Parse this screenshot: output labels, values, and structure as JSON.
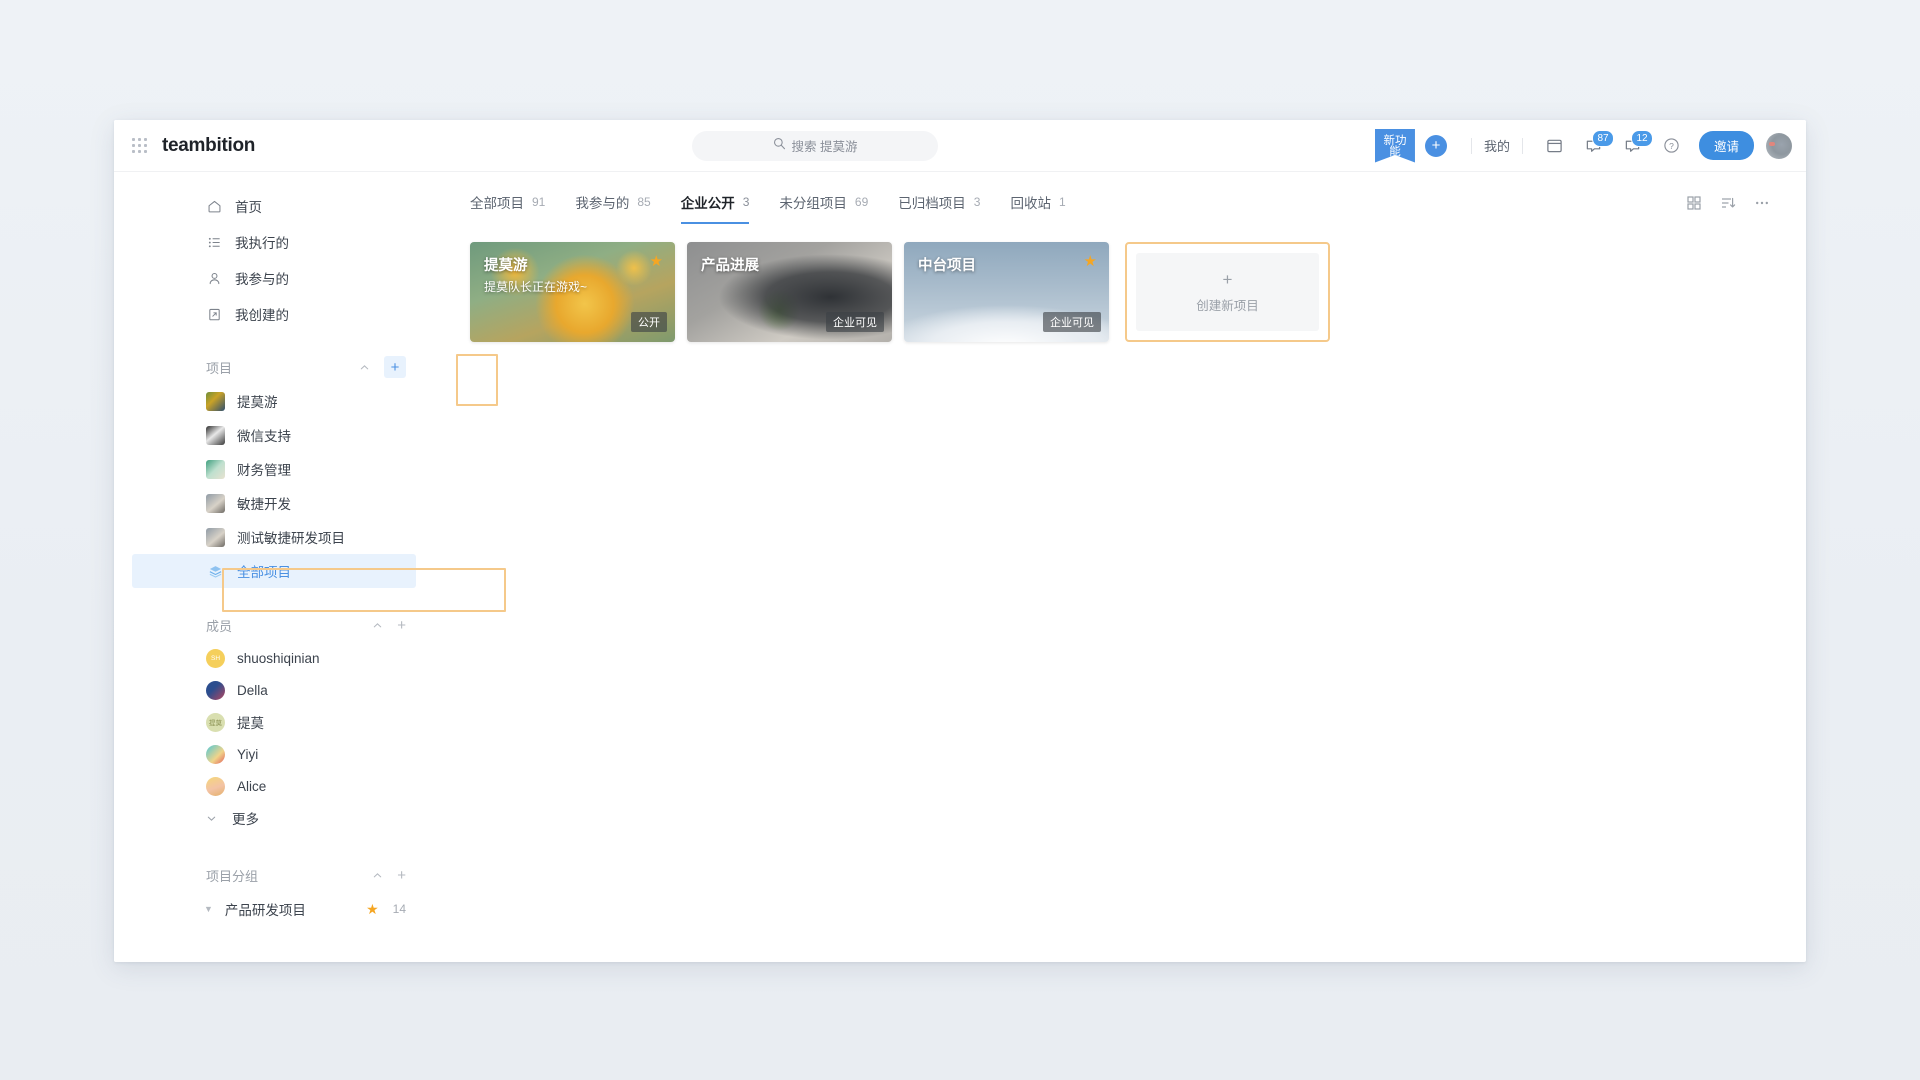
{
  "header": {
    "brand": "teambition",
    "apps_icon": "grid-dots-icon",
    "search": {
      "icon": "search-icon",
      "text": "搜索 提莫游",
      "placeholder": "搜索 提莫游"
    },
    "ribbon_label": "新功能",
    "add_label": "+",
    "my_label": "我的",
    "calendar_icon": "calendar-icon",
    "notifications": [
      {
        "icon": "message-icon",
        "count": "87"
      },
      {
        "icon": "message-icon",
        "count": "12"
      }
    ],
    "help_label": "?",
    "invite_label": "邀请",
    "avatar": "user-avatar"
  },
  "sidebar": {
    "nav": [
      {
        "icon": "home-icon",
        "label": "首页"
      },
      {
        "icon": "list-icon",
        "label": "我执行的"
      },
      {
        "icon": "user-icon",
        "label": "我参与的"
      },
      {
        "icon": "clipboard-icon",
        "label": "我创建的"
      }
    ],
    "projects_section": {
      "title": "项目",
      "collapse_icon": "chevron-up-icon",
      "add_icon": "plus-icon",
      "items": [
        {
          "label": "提莫游",
          "thumb": "t1"
        },
        {
          "label": "微信支持",
          "thumb": "t2"
        },
        {
          "label": "财务管理",
          "thumb": "t3"
        },
        {
          "label": "敏捷开发",
          "thumb": "t4"
        },
        {
          "label": "测试敏捷研发项目",
          "thumb": "t5"
        }
      ],
      "all_projects": {
        "label": "全部项目",
        "icon": "layers-icon"
      }
    },
    "members_section": {
      "title": "成员",
      "collapse_icon": "chevron-up-icon",
      "add_icon": "plus-icon",
      "items": [
        {
          "label": "shuoshiqinian",
          "initials": "SH",
          "av": "mv1"
        },
        {
          "label": "Della",
          "initials": "",
          "av": "mv2"
        },
        {
          "label": "提莫",
          "initials": "提莫",
          "av": "mv3"
        },
        {
          "label": "Yiyi",
          "initials": "",
          "av": "mv4"
        },
        {
          "label": "Alice",
          "initials": "",
          "av": "mv5"
        }
      ],
      "more_label": "更多",
      "more_icon": "chevron-down-icon"
    },
    "groups_section": {
      "title": "项目分组",
      "collapse_icon": "chevron-up-icon",
      "add_icon": "plus-icon",
      "items": [
        {
          "label": "产品研发项目",
          "starred": true,
          "count": "14",
          "caret": "caret-down-icon"
        }
      ]
    }
  },
  "main": {
    "tabs": [
      {
        "label": "全部项目",
        "count": "91",
        "active": false
      },
      {
        "label": "我参与的",
        "count": "85",
        "active": false
      },
      {
        "label": "企业公开",
        "count": "3",
        "active": true
      },
      {
        "label": "未分组项目",
        "count": "69",
        "active": false
      },
      {
        "label": "已归档项目",
        "count": "3",
        "active": false
      },
      {
        "label": "回收站",
        "count": "1",
        "active": false
      }
    ],
    "view_tools": [
      {
        "icon": "grid-view-icon"
      },
      {
        "icon": "sort-icon"
      },
      {
        "icon": "more-horizontal-icon"
      }
    ],
    "cards": [
      {
        "title": "提莫游",
        "subtitle": "提莫队长正在游戏~",
        "badge": "公开",
        "starred": true,
        "visual": "cv1"
      },
      {
        "title": "产品进展",
        "subtitle": "",
        "badge": "企业可见",
        "starred": false,
        "visual": "cv2"
      },
      {
        "title": "中台项目",
        "subtitle": "",
        "badge": "企业可见",
        "starred": true,
        "visual": "cv3"
      }
    ],
    "create_card": {
      "plus": "+",
      "label": "创建新项目",
      "icon": "plus-icon"
    }
  },
  "colors": {
    "accent": "#4a90e2",
    "highlight_border": "#f5c98a",
    "star": "#f5a623",
    "selected_bg": "#e8f2fd"
  }
}
